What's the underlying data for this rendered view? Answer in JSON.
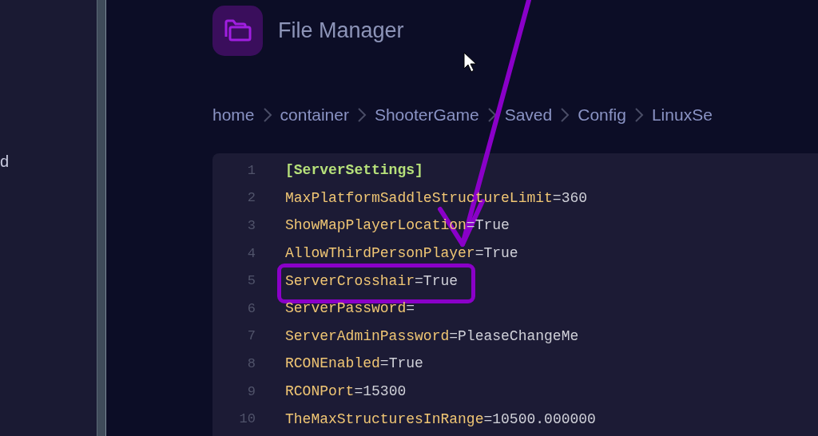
{
  "sidebar": {
    "items": [
      {
        "label": "d"
      }
    ]
  },
  "header": {
    "title": "File Manager"
  },
  "breadcrumb": [
    {
      "label": "home"
    },
    {
      "label": "container"
    },
    {
      "label": "ShooterGame"
    },
    {
      "label": "Saved"
    },
    {
      "label": "Config"
    },
    {
      "label": "LinuxSe"
    }
  ],
  "editor": {
    "lines": [
      {
        "number": "1",
        "kind": "section",
        "text": "[ServerSettings]",
        "highlighted": false
      },
      {
        "number": "2",
        "kind": "setting",
        "key": "MaxPlatformSaddleStructureLimit",
        "separator": "=",
        "value": "360",
        "highlighted": false
      },
      {
        "number": "3",
        "kind": "setting",
        "key": "ShowMapPlayerLocation",
        "separator": "=",
        "value": "True",
        "highlighted": false
      },
      {
        "number": "4",
        "kind": "setting",
        "key": "AllowThirdPersonPlayer",
        "separator": "=",
        "value": "True",
        "highlighted": false
      },
      {
        "number": "5",
        "kind": "setting",
        "key": "ServerCrosshair",
        "separator": "=",
        "value": "True",
        "highlighted": true
      },
      {
        "number": "6",
        "kind": "setting",
        "key": "ServerPassword",
        "separator": "=",
        "highlighted": false
      },
      {
        "number": "7",
        "kind": "setting",
        "key": "ServerAdminPassword",
        "separator": "=",
        "value": "PleaseChangeMe",
        "highlighted": false
      },
      {
        "number": "8",
        "kind": "setting",
        "key": "RCONEnabled",
        "separator": "=",
        "value": "True",
        "highlighted": false
      },
      {
        "number": "9",
        "kind": "setting",
        "key": "RCONPort",
        "separator": "=",
        "value": "15300",
        "highlighted": false
      },
      {
        "number": "10",
        "kind": "setting",
        "key": "TheMaxStructuresInRange",
        "separator": "=",
        "value": "10500.000000",
        "highlighted": false
      }
    ]
  }
}
